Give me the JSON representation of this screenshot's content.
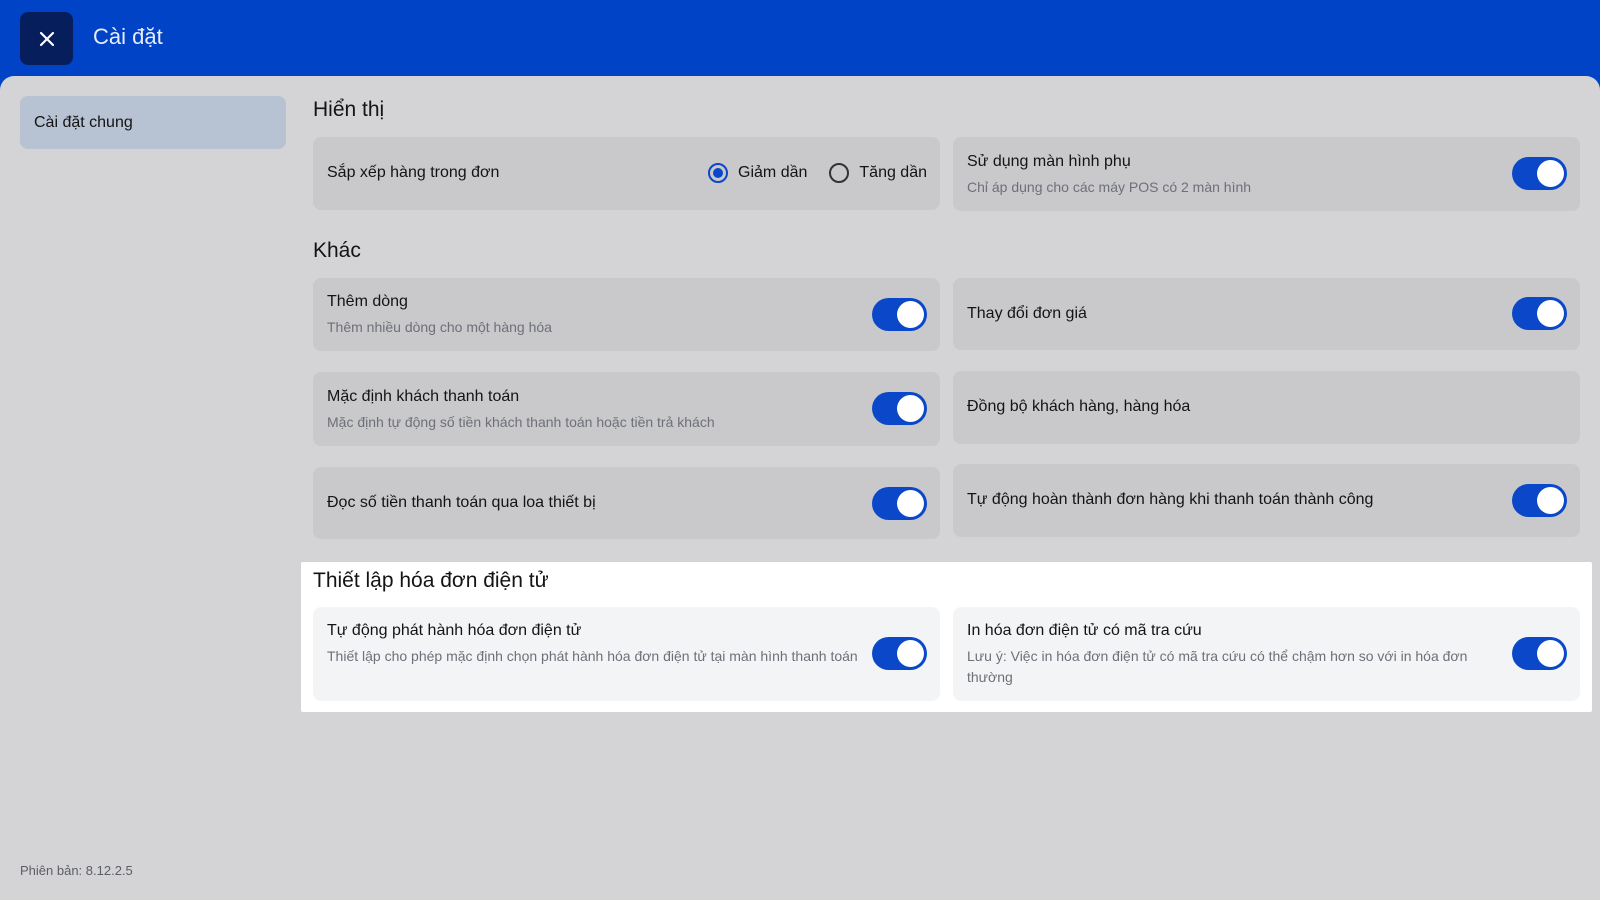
{
  "header": {
    "title": "Cài đặt",
    "close_icon": "close-icon"
  },
  "sidebar": {
    "items": [
      {
        "label": "Cài đặt chung",
        "selected": true
      }
    ]
  },
  "sections": {
    "display": {
      "title": "Hiển thị",
      "sort_items": {
        "title": "Sắp xếp hàng trong đơn",
        "options": [
          "Giảm dần",
          "Tăng dần"
        ],
        "selected": "Giảm dần"
      },
      "secondary_screen": {
        "title": "Sử dụng màn hình phụ",
        "subtitle": "Chỉ áp dụng cho các máy POS có 2 màn hình",
        "enabled": true
      }
    },
    "other": {
      "title": "Khác",
      "add_row": {
        "title": "Thêm dòng",
        "subtitle": "Thêm nhiều dòng cho một hàng hóa",
        "enabled": true
      },
      "change_price": {
        "title": "Thay đổi đơn giá",
        "enabled": true
      },
      "default_payment": {
        "title": "Mặc định khách thanh toán",
        "subtitle": "Mặc định tự động số tiền khách thanh toán hoặc tiền trả khách",
        "enabled": true
      },
      "sync": {
        "title": "Đồng bộ khách hàng, hàng hóa"
      },
      "read_amount": {
        "title": "Đọc số tiền thanh toán qua loa thiết bị",
        "enabled": true
      },
      "auto_complete": {
        "title": "Tự động hoàn thành đơn hàng khi thanh toán thành công",
        "enabled": true
      }
    },
    "einvoice": {
      "title": "Thiết lập hóa đơn điện tử",
      "auto_issue": {
        "title": "Tự động phát hành hóa đơn điện tử",
        "subtitle": "Thiết lập cho phép mặc định chọn phát hành hóa đơn điện tử tại màn hình thanh toán",
        "enabled": true
      },
      "print_lookup": {
        "title": "In hóa đơn điện tử có mã tra cứu",
        "subtitle": "Lưu ý: Việc in hóa đơn điện tử có mã tra cứu có thể chậm hơn so với in hóa đơn thường",
        "enabled": true
      }
    }
  },
  "footer": {
    "version": "Phiên bản: 8.12.2.5"
  },
  "colors": {
    "header_bg": "#0043c7",
    "toggle_on": "#0a47c9",
    "content_bg": "#d4d4d6"
  }
}
